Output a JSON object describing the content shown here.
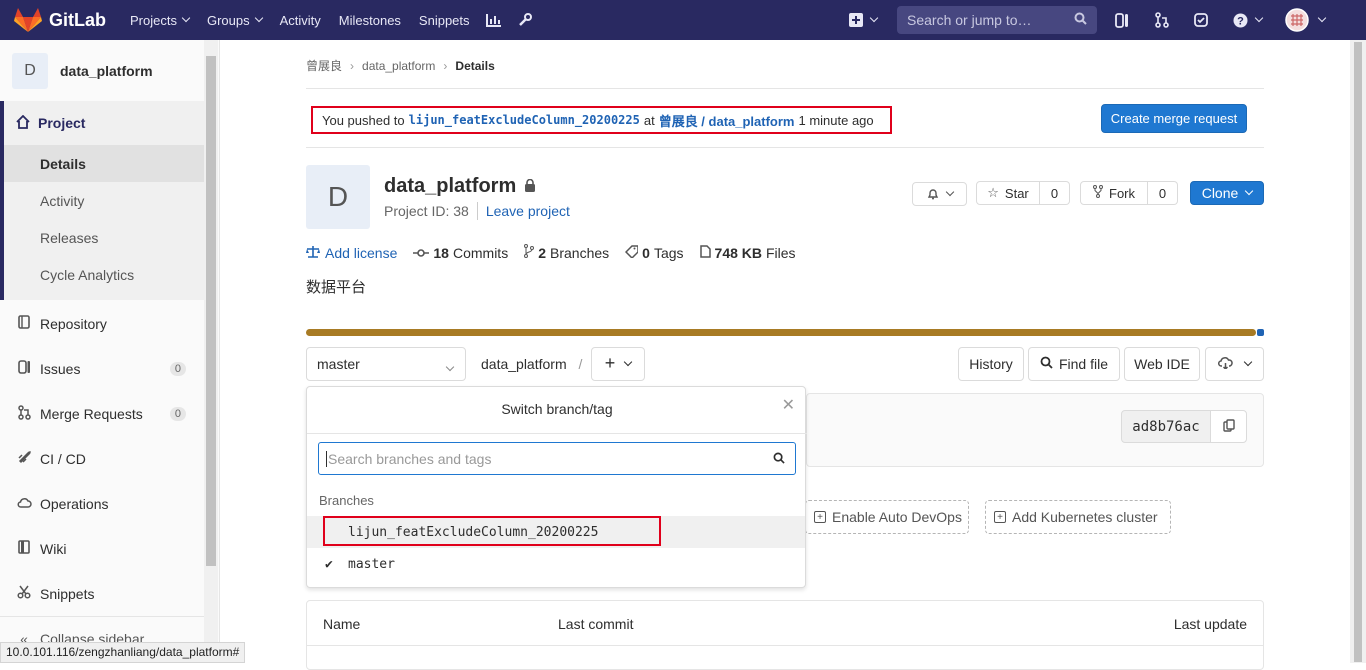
{
  "nav": {
    "brand": "GitLab",
    "links": [
      "Projects",
      "Groups",
      "Activity",
      "Milestones",
      "Snippets"
    ],
    "search_placeholder": "Search or jump to…",
    "icons": [
      "chart-icon",
      "wrench-icon",
      "plus-icon",
      "issues-icon",
      "merge-request-icon",
      "todo-icon",
      "help-icon",
      "user-avatar"
    ]
  },
  "sidebar": {
    "avatar_letter": "D",
    "project_name": "data_platform",
    "section": "Project",
    "sub_items": [
      "Details",
      "Activity",
      "Releases",
      "Cycle Analytics"
    ],
    "items": [
      {
        "label": "Repository",
        "icon": "book-icon"
      },
      {
        "label": "Issues",
        "icon": "issues-icon",
        "count": "0"
      },
      {
        "label": "Merge Requests",
        "icon": "merge-request-icon",
        "count": "0"
      },
      {
        "label": "CI / CD",
        "icon": "rocket-icon"
      },
      {
        "label": "Operations",
        "icon": "cloud-gear-icon"
      },
      {
        "label": "Wiki",
        "icon": "book-icon"
      },
      {
        "label": "Snippets",
        "icon": "scissors-icon"
      }
    ],
    "collapse": "Collapse sidebar"
  },
  "status_url": "10.0.101.116/zengzhanliang/data_platform#",
  "breadcrumb": [
    "曾展良",
    "data_platform",
    "Details"
  ],
  "push": {
    "prefix": "You pushed to",
    "branch": "lijun_featExcludeColumn_20200225",
    "at": "at",
    "project": "曾展良 / data_platform",
    "time": "1 minute ago"
  },
  "create_mr": "Create merge request",
  "project": {
    "avatar_letter": "D",
    "name": "data_platform",
    "id_text": "Project ID: 38",
    "leave": "Leave project",
    "description": "数据平台"
  },
  "actions": {
    "star": "Star",
    "star_count": "0",
    "fork": "Fork",
    "fork_count": "0",
    "clone": "Clone"
  },
  "stats": {
    "license": "Add license",
    "commits_n": "18",
    "commits": "Commits",
    "branches_n": "2",
    "branches": "Branches",
    "tags_n": "0",
    "tags": "Tags",
    "files_n": "748 KB",
    "files": "Files"
  },
  "repo": {
    "branch": "master",
    "path": "data_platform",
    "path_sep": "/",
    "history": "History",
    "find_file": "Find file",
    "web_ide": "Web IDE"
  },
  "dropdown": {
    "title": "Switch branch/tag",
    "search_placeholder": "Search branches and tags",
    "section": "Branches",
    "branches": [
      "lijun_featExcludeColumn_20200225",
      "master"
    ]
  },
  "commit": {
    "sha": "ad8b76ac"
  },
  "setup": {
    "auto_devops": "Enable Auto DevOps",
    "k8s": "Add Kubernetes cluster"
  },
  "table": {
    "headers": [
      "Name",
      "Last commit",
      "Last update"
    ]
  },
  "colors": {
    "nav_bg": "#292961",
    "primary": "#1f78d1",
    "highlight_box": "#e0001b",
    "lang_main": "#a87b24",
    "lang_second": "#1f63b4"
  }
}
